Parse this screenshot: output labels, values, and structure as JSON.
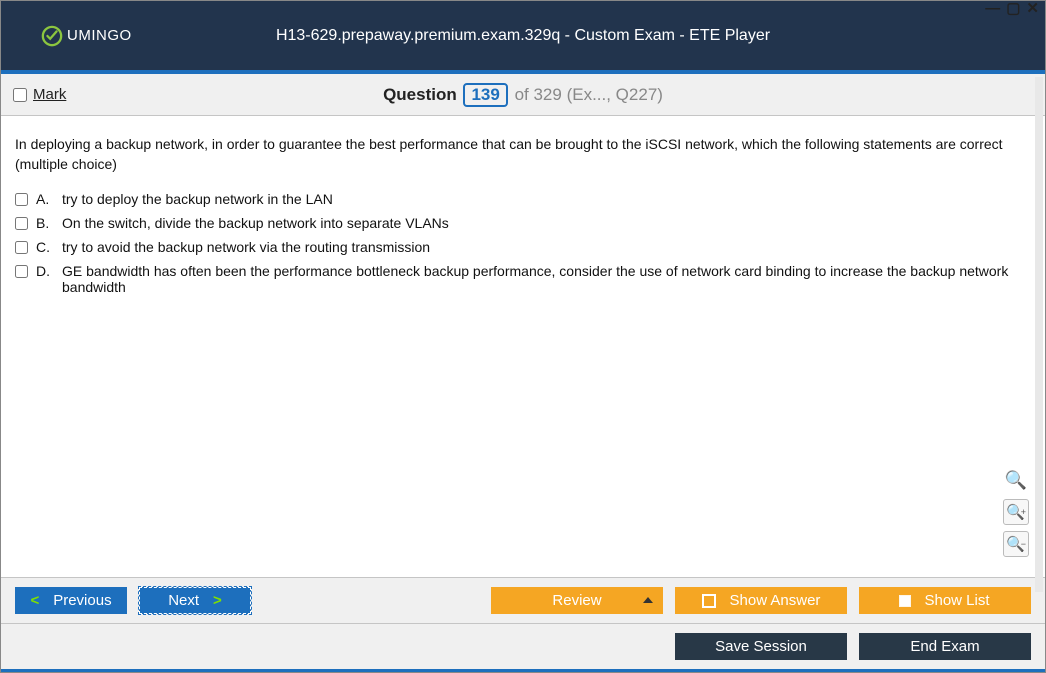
{
  "brand": "UMINGO",
  "title": "H13-629.prepaway.premium.exam.329q - Custom Exam - ETE Player",
  "mark_label": "Mark",
  "qline": {
    "prefix": "Question",
    "number": "139",
    "suffix": " of 329 (Ex..., Q227)"
  },
  "question": {
    "text": "In deploying a backup network, in order to guarantee the best performance that can be brought to the iSCSI network, which the following statements are correct (multiple choice)",
    "options": [
      {
        "letter": "A.",
        "text": "try to deploy the backup network in the LAN"
      },
      {
        "letter": "B.",
        "text": "On the switch, divide the backup network into separate VLANs"
      },
      {
        "letter": "C.",
        "text": "try to avoid the backup network via the routing transmission"
      },
      {
        "letter": "D.",
        "text": "GE bandwidth has often been the performance bottleneck backup performance, consider the use of network card binding to increase the backup network bandwidth"
      }
    ]
  },
  "buttons": {
    "previous": "Previous",
    "next": "Next",
    "review": "Review",
    "show_answer": "Show Answer",
    "show_list": "Show List",
    "save_session": "Save Session",
    "end_exam": "End Exam"
  }
}
